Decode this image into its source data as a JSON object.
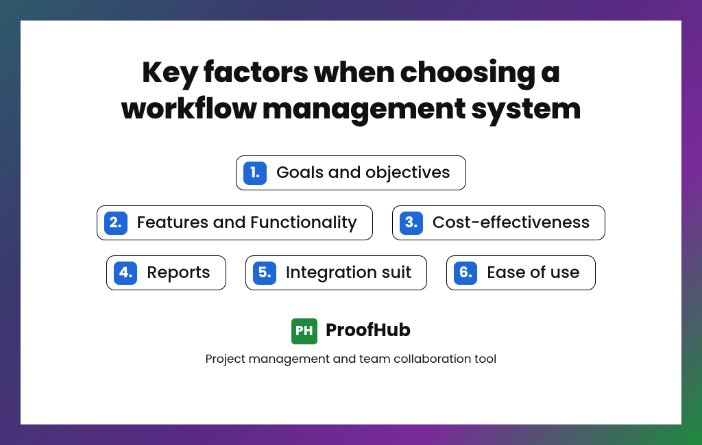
{
  "title": "Key factors when choosing a workflow management system",
  "factors": [
    {
      "n": "1.",
      "label": "Goals and objectives"
    },
    {
      "n": "2.",
      "label": "Features and Functionality"
    },
    {
      "n": "3.",
      "label": "Cost-effectiveness"
    },
    {
      "n": "4.",
      "label": "Reports"
    },
    {
      "n": "5.",
      "label": "Integration suit"
    },
    {
      "n": "6.",
      "label": "Ease of use"
    }
  ],
  "brand": {
    "logo_text": "PH",
    "name": "ProofHub",
    "tagline": "Project management and team collaboration tool"
  },
  "colors": {
    "number_bg": "#1f66d6",
    "logo_bg": "#1f8a3d"
  }
}
